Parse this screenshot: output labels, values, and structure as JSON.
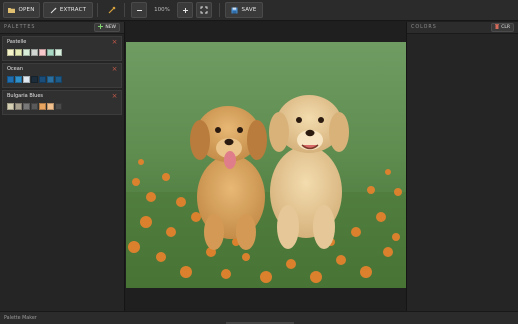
{
  "toolbar": {
    "open_label": "OPEN",
    "extract_label": "EXTRACT",
    "zoom_level": "100%",
    "save_label": "SAVE"
  },
  "palettes_panel": {
    "title": "PALETTES",
    "new_label": "NEW",
    "items": [
      {
        "name": "Pastelle",
        "colors": [
          "#f4f4c8",
          "#e7ecb7",
          "#d9eed8",
          "#cfd4d1",
          "#f6c8cb",
          "#a8d8c3",
          "#d9f0df"
        ]
      },
      {
        "name": "Ocean",
        "colors": [
          "#1f6fb0",
          "#2f8fc8",
          "#dfe8f0",
          "#1c2c3a",
          "#1a4d7a",
          "#2b6fa0",
          "#1d5a88"
        ]
      },
      {
        "name": "Bulgaria Blues",
        "colors": [
          "#d5cfb3",
          "#a9a291",
          "#787878",
          "#595959",
          "#e8a560",
          "#f2c08c",
          "#4a4a4a"
        ]
      }
    ]
  },
  "colors_panel": {
    "title": "COLORS",
    "clear_label": "CLR"
  },
  "status": {
    "text": "Palette Maker"
  },
  "icons": {
    "open": "folder-icon",
    "extract": "wand-icon",
    "eyedropper": "eyedropper-icon",
    "zoom_out": "minus-icon",
    "zoom_in": "plus-icon",
    "fit": "fit-screen-icon",
    "save": "save-icon",
    "add": "plus-icon",
    "close": "close-icon"
  },
  "colors": {
    "accent": "#3a3a3a",
    "close_red": "#c65a4a",
    "panel_bg": "#252525",
    "toolbar_bg": "#2b2b2b",
    "canvas_bg": "#1f1f1f"
  }
}
